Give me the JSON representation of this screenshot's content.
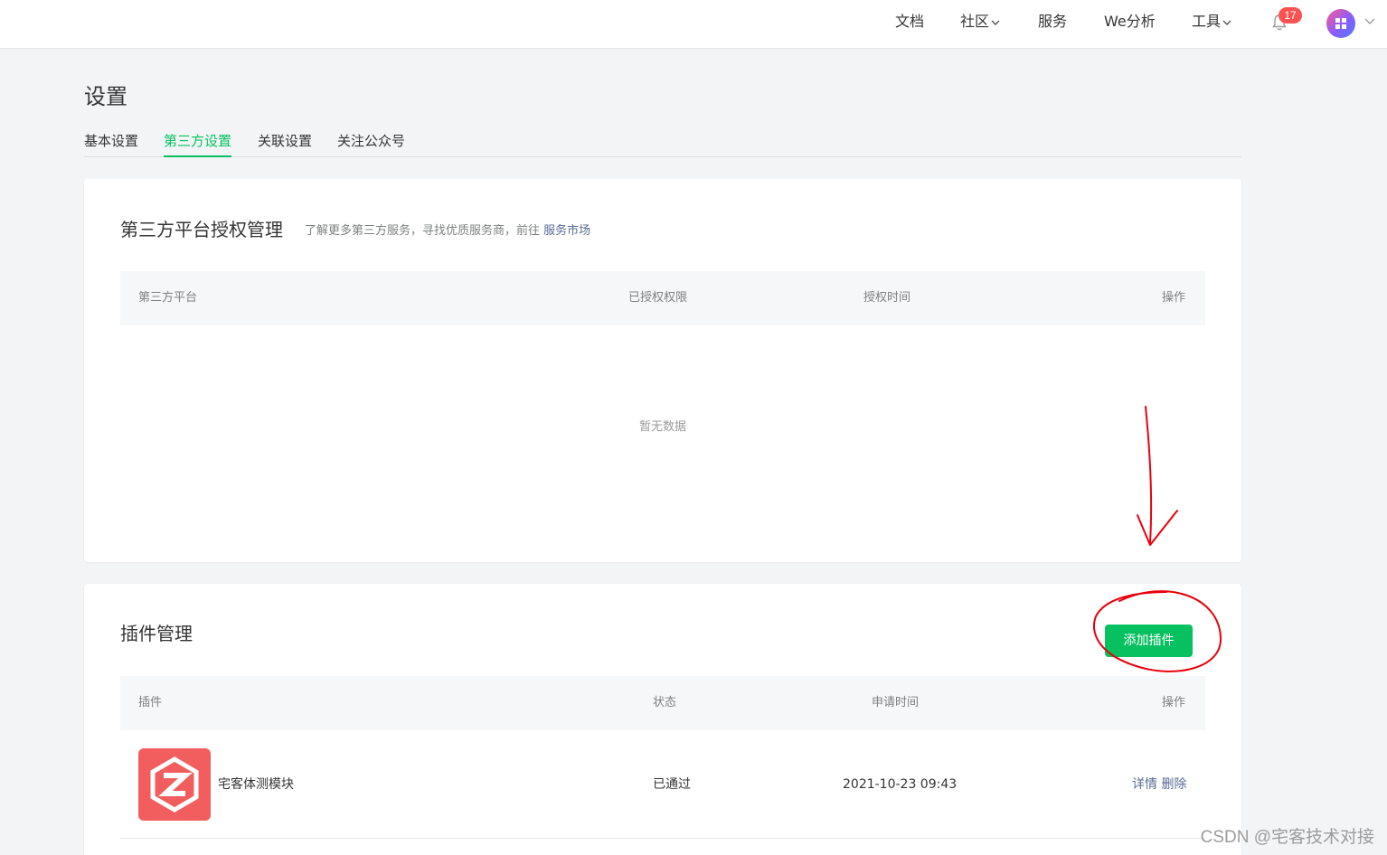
{
  "nav": {
    "links": [
      {
        "label": "文档"
      },
      {
        "label": "社区"
      },
      {
        "label": "服务"
      },
      {
        "label": "We分析"
      },
      {
        "label": "工具"
      }
    ],
    "notification_count": "17",
    "icons": {
      "bell": "bell-icon",
      "chevron": "chevron-down-icon",
      "avatar": "avatar"
    }
  },
  "page": {
    "title": "设置",
    "tabs": [
      {
        "label": "基本设置",
        "active": false
      },
      {
        "label": "第三方设置",
        "active": true
      },
      {
        "label": "关联设置",
        "active": false
      },
      {
        "label": "关注公众号",
        "active": false
      }
    ]
  },
  "third_party": {
    "title": "第三方平台授权管理",
    "tip_prefix": "了解更多第三方服务，寻找优质服务商，前往",
    "tip_link": "服务市场",
    "columns": [
      "第三方平台",
      "已授权权限",
      "授权时间",
      "操作"
    ],
    "empty_text": "暂无数据"
  },
  "plugins": {
    "title": "插件管理",
    "add_button": "添加插件",
    "columns": [
      "插件",
      "状态",
      "申请时间",
      "操作"
    ],
    "rows": [
      {
        "name": "宅客体测模块",
        "status": "已通过",
        "applied_at": "2021-10-23 09:43",
        "actions": [
          "详情",
          "删除"
        ],
        "logo_color": "#f25e5e"
      }
    ]
  },
  "watermark": "CSDN @宅客技术对接",
  "colors": {
    "accent": "#07c160",
    "link": "#576b95",
    "badge": "#fa5151",
    "annotation": "#e8000b"
  }
}
